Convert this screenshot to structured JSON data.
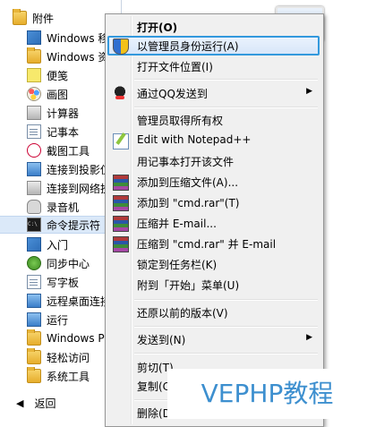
{
  "start_list": {
    "items": [
      {
        "label": "附件",
        "icon": "folder-icon"
      },
      {
        "label": "Windows 移",
        "icon": "windows-mobility-icon"
      },
      {
        "label": "Windows 资",
        "icon": "windows-explorer-icon"
      },
      {
        "label": "便笺",
        "icon": "sticky-notes-icon"
      },
      {
        "label": "画图",
        "icon": "paint-icon"
      },
      {
        "label": "计算器",
        "icon": "calculator-icon"
      },
      {
        "label": "记事本",
        "icon": "notepad-icon"
      },
      {
        "label": "截图工具",
        "icon": "snipping-tool-icon"
      },
      {
        "label": "连接到投影仪",
        "icon": "projector-icon"
      },
      {
        "label": "连接到网络投",
        "icon": "network-projector-icon"
      },
      {
        "label": "录音机",
        "icon": "microphone-icon"
      },
      {
        "label": "命令提示符",
        "icon": "cmd-icon"
      },
      {
        "label": "入门",
        "icon": "getting-started-icon"
      },
      {
        "label": "同步中心",
        "icon": "sync-center-icon"
      },
      {
        "label": "写字板",
        "icon": "wordpad-icon"
      },
      {
        "label": "远程桌面连接",
        "icon": "remote-desktop-icon"
      },
      {
        "label": "运行",
        "icon": "run-icon"
      },
      {
        "label": "Windows P",
        "icon": "folder-icon"
      },
      {
        "label": "轻松访问",
        "icon": "folder-icon"
      },
      {
        "label": "系统工具",
        "icon": "folder-icon"
      }
    ],
    "back_label": "返回"
  },
  "context_menu": {
    "items": [
      {
        "label": "打开(O)",
        "icon": ""
      },
      {
        "label": "以管理员身份运行(A)",
        "icon": "uac-shield-icon"
      },
      {
        "label": "打开文件位置(I)",
        "icon": ""
      },
      {
        "label": "通过QQ发送到",
        "icon": "qq-icon"
      },
      {
        "label": "管理员取得所有权",
        "icon": ""
      },
      {
        "label": "Edit with Notepad++",
        "icon": "notepad-plus-plus-icon"
      },
      {
        "label": "用记事本打开该文件",
        "icon": ""
      },
      {
        "label": "添加到压缩文件(A)...",
        "icon": "winrar-icon"
      },
      {
        "label": "添加到 \"cmd.rar\"(T)",
        "icon": "winrar-icon"
      },
      {
        "label": "压缩并 E-mail...",
        "icon": "winrar-icon"
      },
      {
        "label": "压缩到 \"cmd.rar\" 并 E-mail",
        "icon": "winrar-icon"
      },
      {
        "label": "锁定到任务栏(K)",
        "icon": ""
      },
      {
        "label": "附到「开始」菜单(U)",
        "icon": ""
      },
      {
        "label": "还原以前的版本(V)",
        "icon": ""
      },
      {
        "label": "发送到(N)",
        "icon": ""
      },
      {
        "label": "剪切(T)",
        "icon": ""
      },
      {
        "label": "复制(C)",
        "icon": ""
      },
      {
        "label": "删除(D)",
        "icon": ""
      }
    ],
    "submenu_arrow": "▶"
  },
  "watermark": "VEPHP教程"
}
